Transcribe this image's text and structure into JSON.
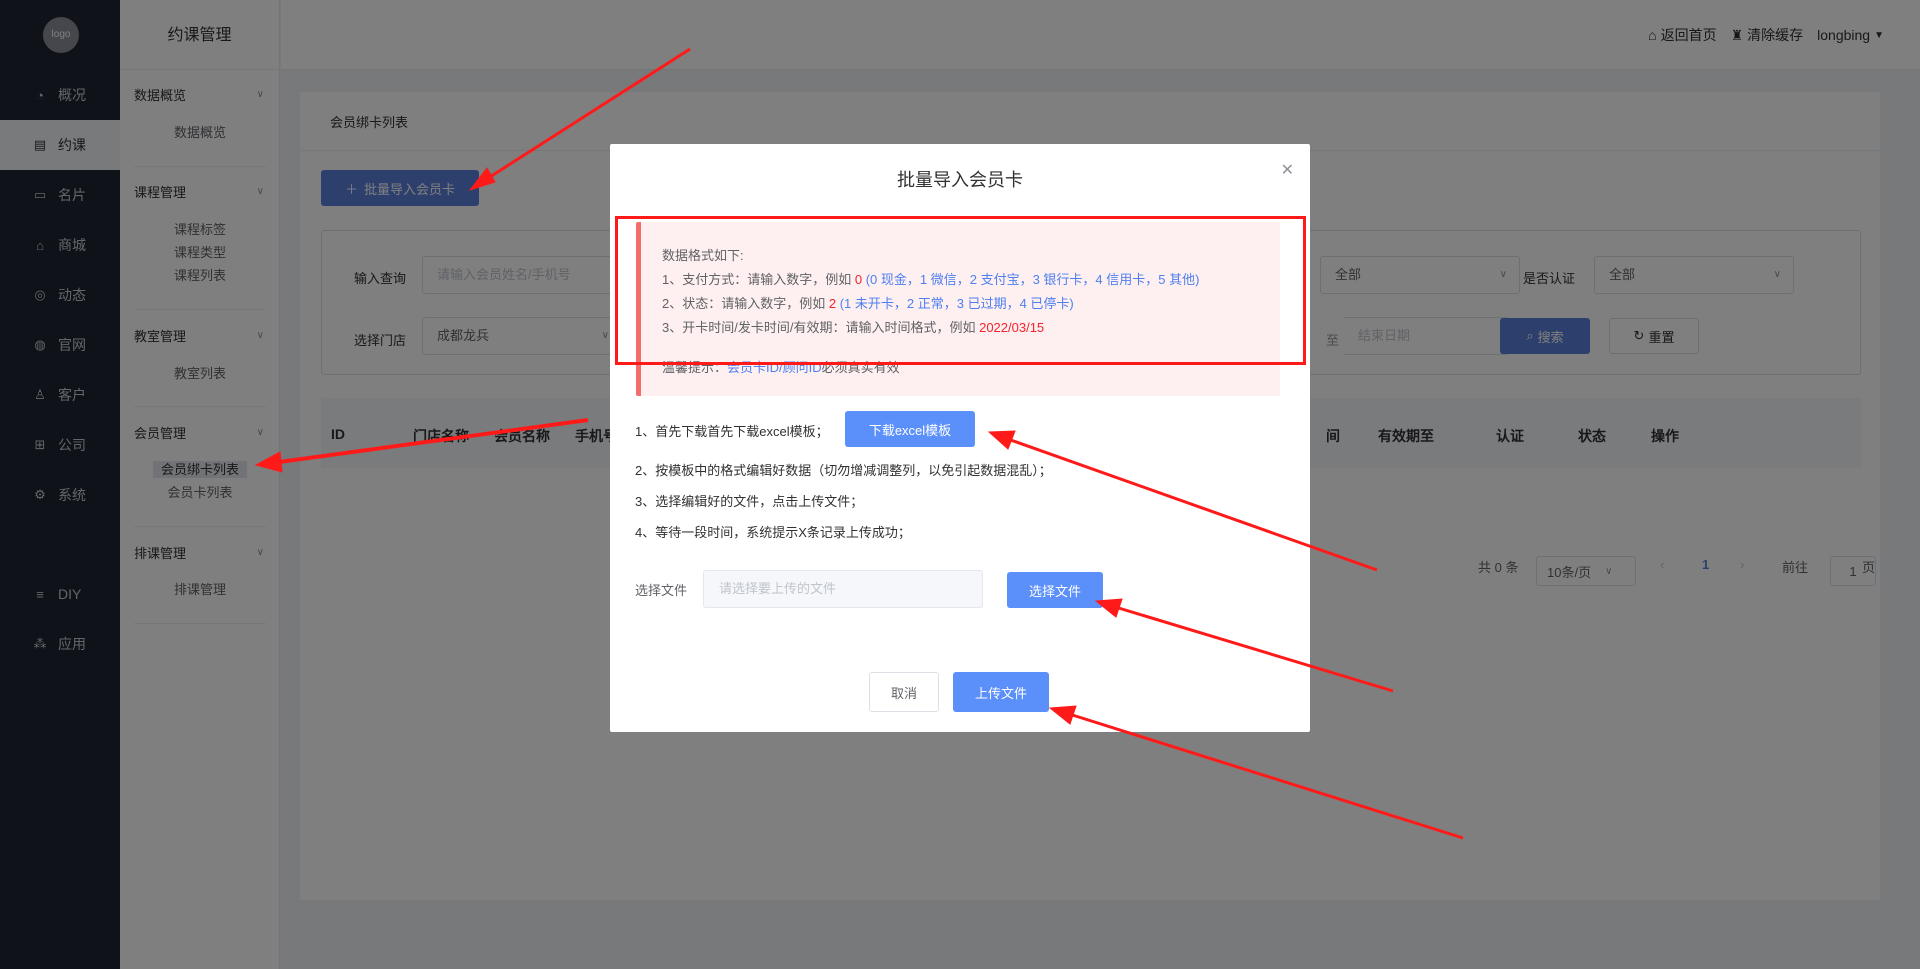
{
  "sidebar": {
    "logo_text": "logo",
    "items": [
      {
        "icon": "pie-chart-icon",
        "glyph": "◔",
        "label": "概况"
      },
      {
        "icon": "calendar-icon",
        "glyph": "▤",
        "label": "约课"
      },
      {
        "icon": "card-icon",
        "glyph": "▭",
        "label": "名片"
      },
      {
        "icon": "shop-bag-icon",
        "glyph": "⌂",
        "label": "商城"
      },
      {
        "icon": "compass-icon",
        "glyph": "◎",
        "label": "动态"
      },
      {
        "icon": "globe-icon",
        "glyph": "◍",
        "label": "官网"
      },
      {
        "icon": "user-icon",
        "glyph": "♙",
        "label": "客户"
      },
      {
        "icon": "org-icon",
        "glyph": "⊞",
        "label": "公司"
      },
      {
        "icon": "gear-icon",
        "glyph": "⚙",
        "label": "系统"
      },
      {
        "icon": "diy-icon",
        "glyph": "≡",
        "label": "DIY"
      },
      {
        "icon": "apps-icon",
        "glyph": "⁂",
        "label": "应用"
      }
    ]
  },
  "subnav": {
    "title": "约课管理",
    "groups": [
      {
        "title": "数据概览",
        "items": [
          "数据概览"
        ]
      },
      {
        "title": "课程管理",
        "items": [
          "课程标签",
          "课程类型",
          "课程列表"
        ]
      },
      {
        "title": "教室管理",
        "items": [
          "教室列表"
        ]
      },
      {
        "title": "会员管理",
        "items": [
          "会员绑卡列表",
          "会员卡列表"
        ]
      },
      {
        "title": "排课管理",
        "items": [
          "排课管理"
        ]
      }
    ]
  },
  "topbar": {
    "home": "返回首页",
    "clear_cache": "清除缓存",
    "user": "longbing"
  },
  "main": {
    "breadcrumb": "会员绑卡列表",
    "import_button": "批量导入会员卡",
    "filters": {
      "query_label": "输入查询",
      "query_placeholder": "请输入会员姓名/手机号",
      "store_label": "选择门店",
      "store_value": "成都龙兵",
      "status_value": "全部",
      "verified_label": "是否认证",
      "verified_value": "全部",
      "end_date_placeholder": "结束日期",
      "date_cut_char": "至",
      "search": "搜索",
      "reset": "重置"
    },
    "table_headers": [
      "ID",
      "门店名称",
      "会员名称",
      "手机号",
      "间",
      "有效期至",
      "认证",
      "状态",
      "操作"
    ],
    "pagination": {
      "total": "共 0 条",
      "page_size": "10条/页",
      "current": "1",
      "goto_label": "前往",
      "goto_value": "1",
      "page_unit": "页"
    }
  },
  "dialog": {
    "title": "批量导入会员卡",
    "tip_title": "数据格式如下:",
    "tip_lines": [
      {
        "prefix": "1、支付方式：请输入数字，例如",
        "example": "0",
        "desc": "(0 现金，1 微信，2 支付宝，3 银行卡，4 信用卡，5 其他)"
      },
      {
        "prefix": "2、状态：请输入数字，例如",
        "example": "2",
        "desc": "(1 未开卡，2 正常，3 已过期，4 已停卡)"
      },
      {
        "prefix": "3、开卡时间/发卡时间/有效期：请输入时间格式，例如",
        "example": "2022/03/15",
        "desc": ""
      }
    ],
    "warm_label": "温馨提示：",
    "warm_link": "会员卡ID/顾问ID",
    "warm_text": "必须真实有效",
    "steps": [
      "1、首先下载首先下载excel模板；",
      "2、按模板中的格式编辑好数据（切勿增减调整列，以免引起数据混乱）；",
      "3、选择编辑好的文件，点击上传文件；",
      "4、等待一段时间，系统提示X条记录上传成功；"
    ],
    "download_button": "下载excel模板",
    "file_label": "选择文件",
    "file_placeholder": "请选择要上传的文件",
    "choose_button": "选择文件",
    "cancel": "取消",
    "upload": "上传文件"
  },
  "colors": {
    "accent": "#5b8ff9",
    "annotation": "#ff1a1a",
    "sidebar_bg": "#1f2430"
  }
}
